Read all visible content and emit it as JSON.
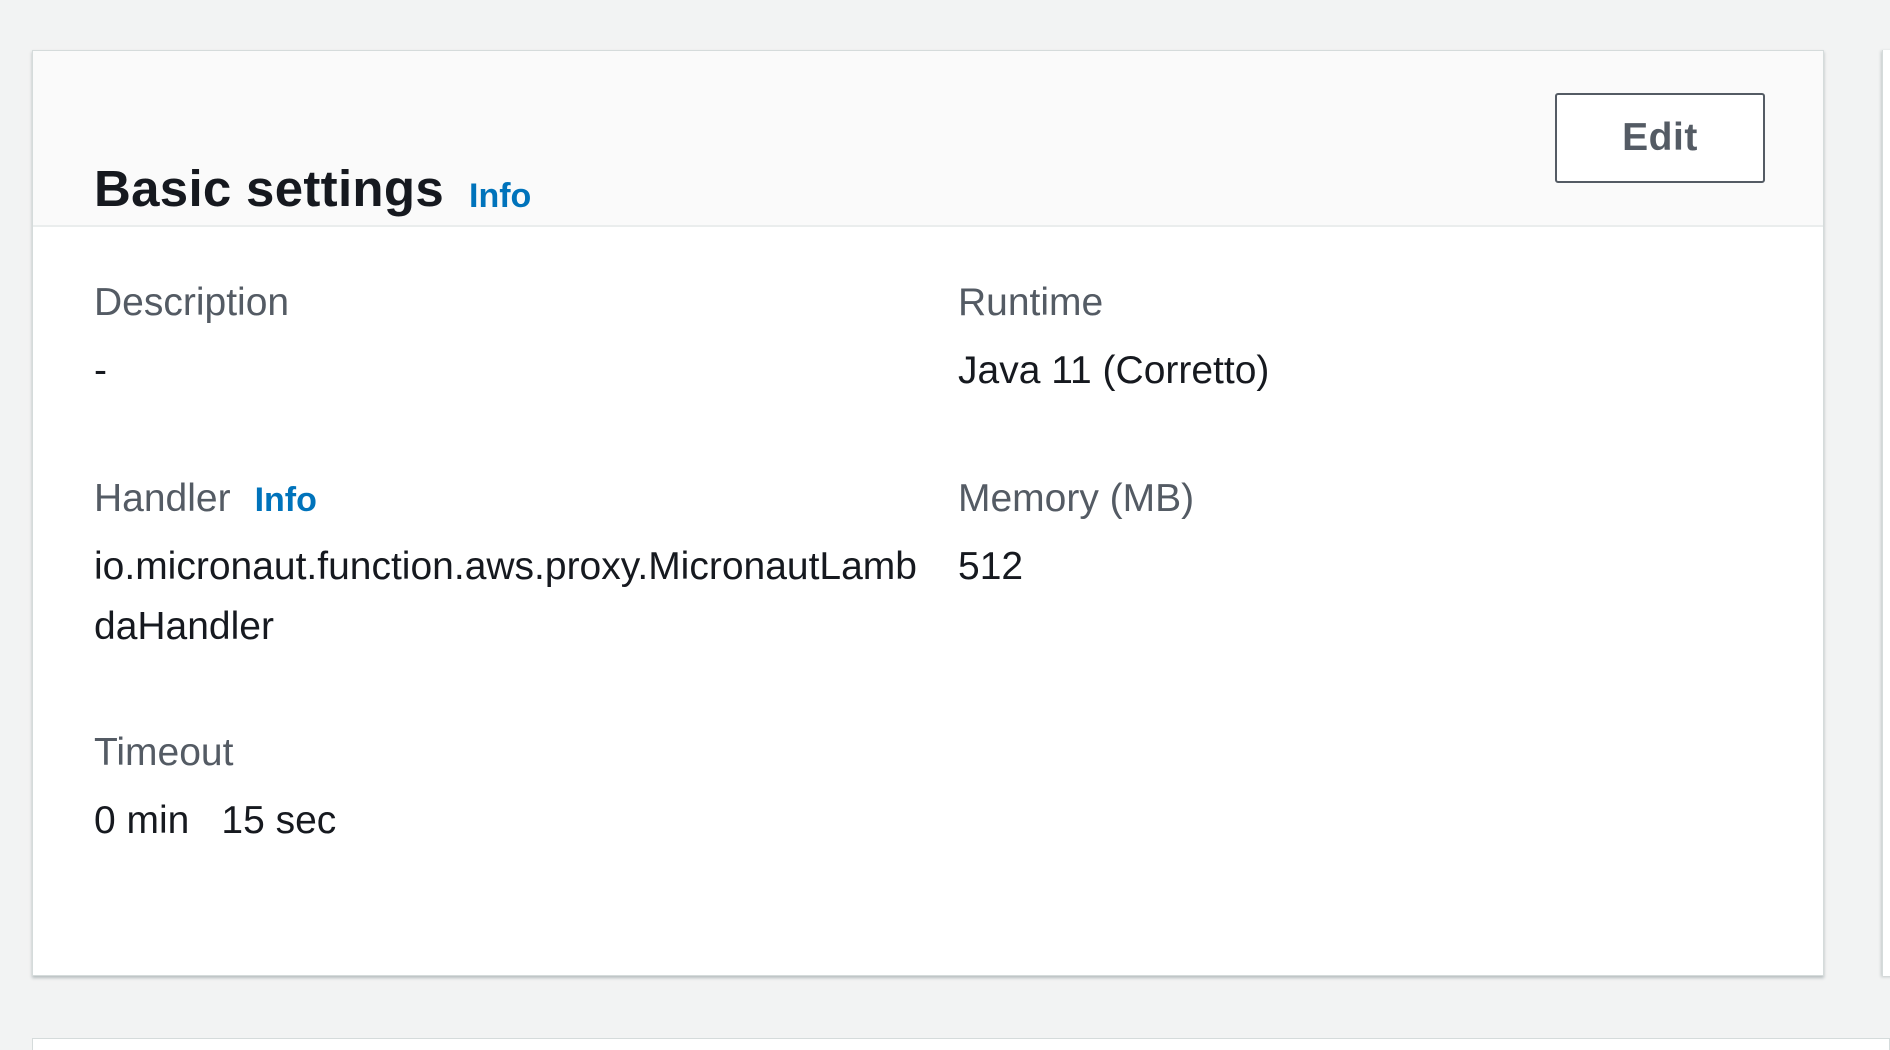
{
  "panel": {
    "title": "Basic settings",
    "info_label": "Info",
    "edit_label": "Edit"
  },
  "fields": {
    "description": {
      "label": "Description",
      "value": "-"
    },
    "runtime": {
      "label": "Runtime",
      "value": "Java 11 (Corretto)"
    },
    "handler": {
      "label": "Handler",
      "info_label": "Info",
      "value": "io.micronaut.function.aws.proxy.MicronautLambdaHandler"
    },
    "memory": {
      "label": "Memory (MB)",
      "value": "512"
    },
    "timeout": {
      "label": "Timeout",
      "minutes": "0 min",
      "seconds": "15 sec"
    }
  },
  "colors": {
    "link": "#0073bb",
    "text": "#16191f",
    "label": "#545b64",
    "background": "#f2f3f3"
  }
}
